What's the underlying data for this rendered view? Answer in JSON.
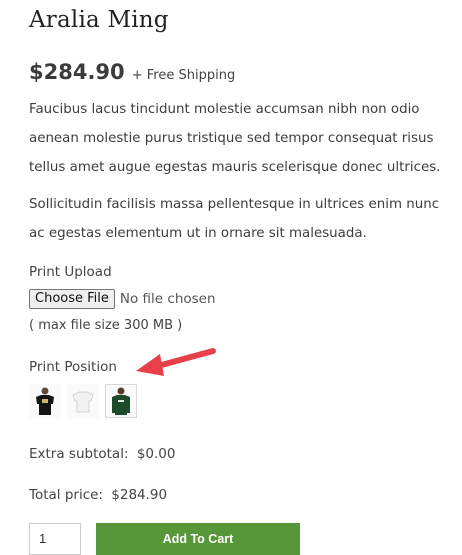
{
  "product": {
    "title": "Aralia Ming",
    "price": "$284.90",
    "shipping": "+ Free Shipping",
    "description": [
      "Faucibus lacus tincidunt molestie accumsan nibh non odio aenean molestie purus tristique sed tempor consequat risus tellus amet augue egestas mauris scelerisque donec ultrices.",
      "Sollicitudin facilisis massa pellentesque in ultrices enim nunc ac egestas elementum ut in ornare sit malesuada."
    ]
  },
  "upload": {
    "label": "Print Upload",
    "button": "Choose File",
    "status": "No file chosen",
    "max_size": "( max file size 300 MB )"
  },
  "position": {
    "label": "Print Position",
    "options": [
      {
        "icon": "front-print-shirt-icon"
      },
      {
        "icon": "white-shirt-icon"
      },
      {
        "icon": "green-sweater-icon",
        "selected": true
      }
    ]
  },
  "totals": {
    "extra_label": "Extra subtotal:",
    "extra_value": "$0.00",
    "total_label": "Total price:",
    "total_value": "$284.90"
  },
  "cart": {
    "quantity": "1",
    "button": "Add To Cart"
  },
  "colors": {
    "accent": "#58963a",
    "annotation_arrow": "#e8404a"
  }
}
